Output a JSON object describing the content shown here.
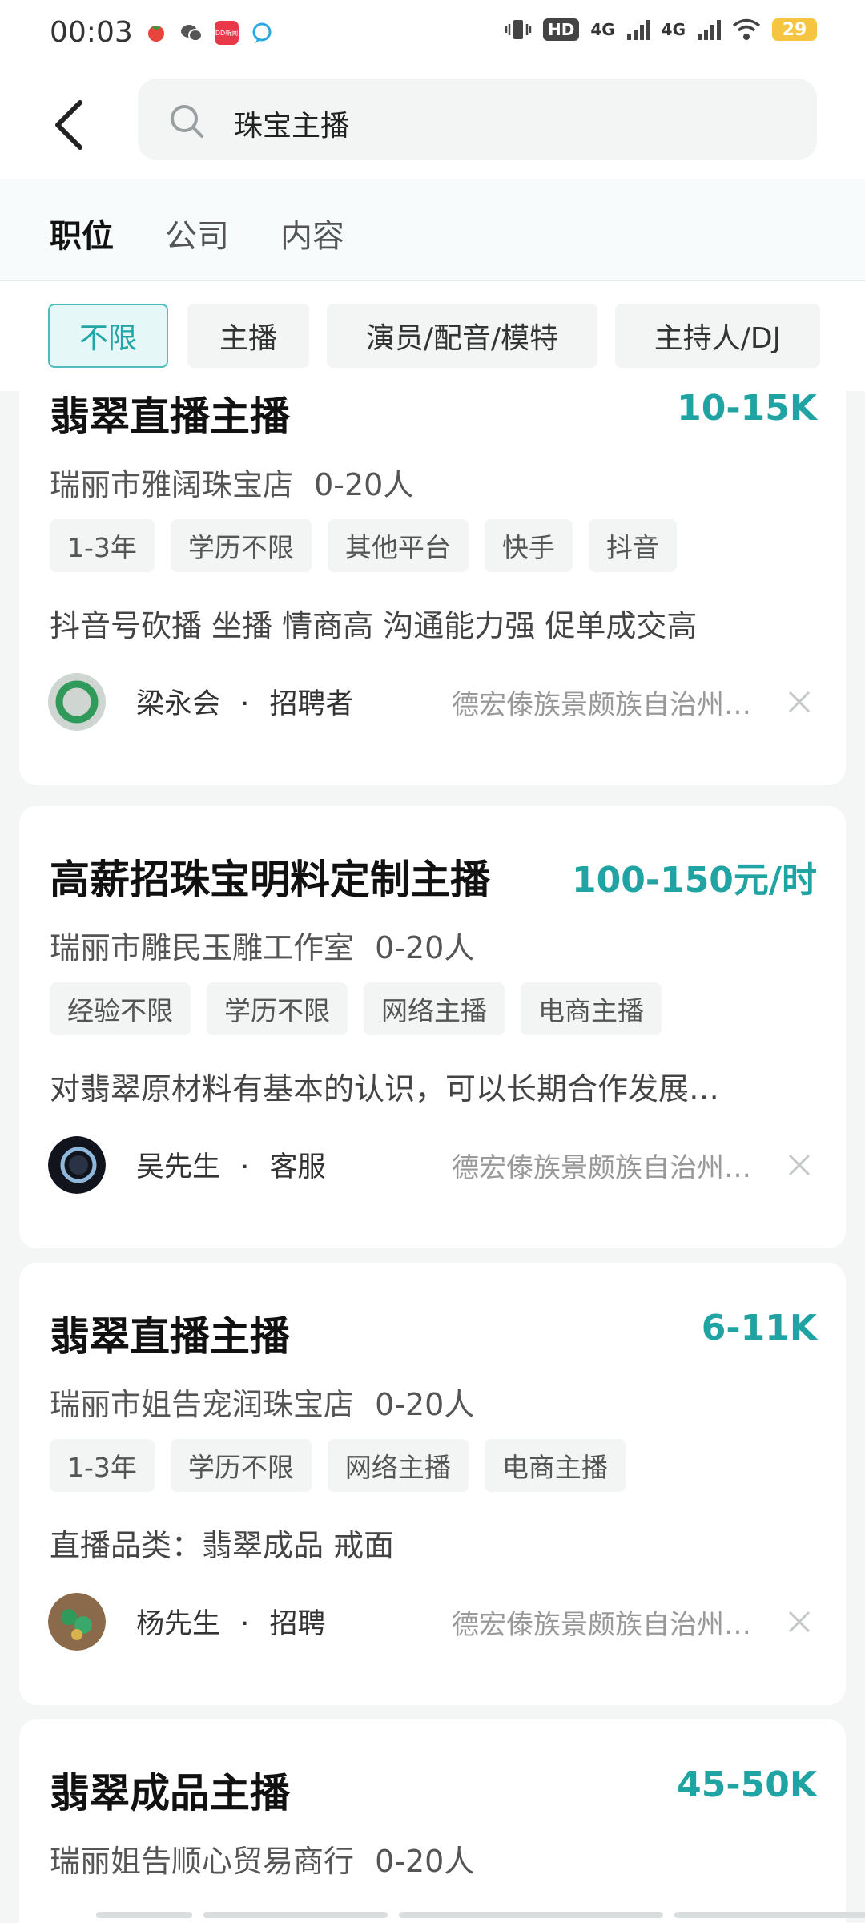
{
  "status_bar": {
    "time": "00:03",
    "notif_icons": [
      {
        "name": "tomato-app-icon",
        "color": "#e5453a"
      },
      {
        "name": "wechat-icon",
        "color": "#555555"
      },
      {
        "name": "news-app-icon",
        "color": "#e8384a",
        "text": "DD新闻"
      },
      {
        "name": "chat-bubble-icon",
        "color": "#2aa7e0"
      }
    ],
    "hd_label": "HD",
    "net1": "4G",
    "net2": "4G",
    "battery": "29"
  },
  "search": {
    "query": "珠宝主播"
  },
  "tabs": [
    {
      "label": "职位",
      "active": true
    },
    {
      "label": "公司",
      "active": false
    },
    {
      "label": "内容",
      "active": false
    }
  ],
  "filters": [
    {
      "label": "不限",
      "active": true
    },
    {
      "label": "主播",
      "active": false
    },
    {
      "label": "演员/配音/模特",
      "active": false
    },
    {
      "label": "主持人/DJ",
      "active": false
    }
  ],
  "jobs": [
    {
      "title": "翡翠直播主播",
      "salary": "10-15K",
      "company": "瑞丽市雅阔珠宝店",
      "size": "0-20人",
      "tags": [
        "1-3年",
        "学历不限",
        "其他平台",
        "快手",
        "抖音"
      ],
      "desc": "抖音号砍播 坐播 情商高 沟通能力强 促单成交高",
      "recruiter": "梁永会",
      "role": "招聘者",
      "location": "德宏傣族景颇族自治州…",
      "avatar_color": "#3aa86b"
    },
    {
      "title": "高薪招珠宝明料定制主播",
      "salary": "100-150元/时",
      "company": "瑞丽市雕民玉雕工作室",
      "size": "0-20人",
      "tags": [
        "经验不限",
        "学历不限",
        "网络主播",
        "电商主播"
      ],
      "desc": "对翡翠原材料有基本的认识，可以长期合作发展…",
      "recruiter": "吴先生",
      "role": "客服",
      "location": "德宏傣族景颇族自治州…",
      "avatar_color": "#1a1f2e"
    },
    {
      "title": "翡翠直播主播",
      "salary": "6-11K",
      "company": "瑞丽市姐告宠润珠宝店",
      "size": "0-20人",
      "tags": [
        "1-3年",
        "学历不限",
        "网络主播",
        "电商主播"
      ],
      "desc": "直播品类：翡翠成品 戒面",
      "recruiter": "杨先生",
      "role": "招聘",
      "location": "德宏傣族景颇族自治州…",
      "avatar_color": "#7a5a3a"
    },
    {
      "title": "翡翠成品主播",
      "salary": "45-50K",
      "company": "瑞丽姐告顺心贸易商行",
      "size": "0-20人"
    }
  ]
}
